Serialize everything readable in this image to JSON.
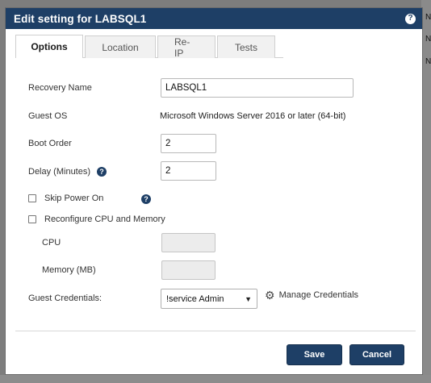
{
  "dialog": {
    "title": "Edit setting for LABSQL1",
    "help_glyph": "?"
  },
  "background": {
    "edge_letters": [
      "N",
      "N",
      "N"
    ]
  },
  "tabs": [
    {
      "label": "Options",
      "active": true
    },
    {
      "label": "Location",
      "active": false
    },
    {
      "label": "Re-IP",
      "active": false
    },
    {
      "label": "Tests",
      "active": false
    }
  ],
  "form": {
    "recovery_name": {
      "label": "Recovery Name",
      "value": "LABSQL1"
    },
    "guest_os": {
      "label": "Guest OS",
      "value": "Microsoft Windows Server 2016 or later (64-bit)"
    },
    "boot_order": {
      "label": "Boot Order",
      "value": "2"
    },
    "delay": {
      "label": "Delay (Minutes)",
      "value": "2"
    },
    "skip_power_on": {
      "label": "Skip Power On",
      "checked": false
    },
    "reconfigure": {
      "label": "Reconfigure CPU and Memory",
      "checked": false
    },
    "cpu": {
      "label": "CPU",
      "value": ""
    },
    "memory": {
      "label": "Memory (MB)",
      "value": ""
    },
    "guest_credentials": {
      "label": "Guest Credentials:",
      "selected": "!service Admin"
    },
    "manage_credentials": "Manage Credentials"
  },
  "buttons": {
    "save": "Save",
    "cancel": "Cancel"
  },
  "colors": {
    "titlebar": "#1e3f66",
    "button": "#1e3f66"
  },
  "icons": {
    "help": "question-circle-icon",
    "gear": "gears-icon",
    "chevron": "chevron-down-icon"
  }
}
